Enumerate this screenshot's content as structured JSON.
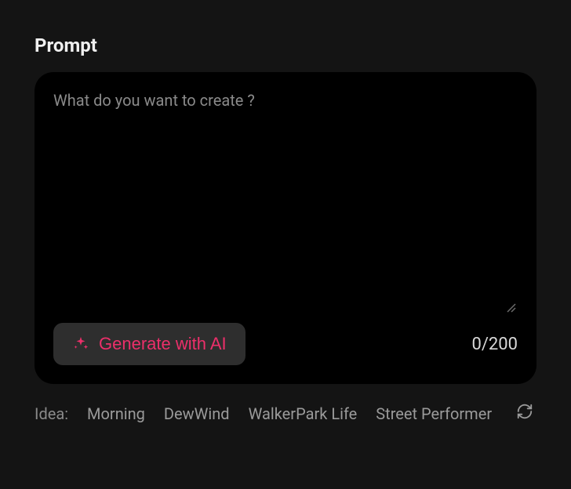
{
  "section": {
    "title": "Prompt"
  },
  "prompt": {
    "placeholder": "What do you want to create ?",
    "value": "",
    "generate_label": "Generate with AI",
    "counter": "0/200"
  },
  "ideas": {
    "label": "Idea:",
    "items": [
      "Morning",
      "DewWind",
      "WalkerPark Life",
      "Street Performer"
    ]
  },
  "colors": {
    "accent": "#ec2f6a"
  }
}
